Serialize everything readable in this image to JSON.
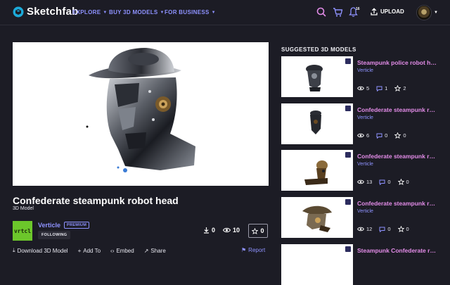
{
  "header": {
    "brand": "Sketchfab",
    "nav": [
      "EXPLORE",
      "BUY 3D MODELS",
      "FOR BUSINESS"
    ],
    "notification_count": "16",
    "upload_label": "UPLOAD"
  },
  "model": {
    "title": "Confederate steampunk robot head",
    "subtitle": "3D Model",
    "author": "Verticle",
    "author_logo_text": "vrtcl",
    "premium_label": "PREMIUM",
    "following_label": "FOLLOWING",
    "downloads": "0",
    "views": "10",
    "likes": "0"
  },
  "actions": {
    "download": "Download 3D Model",
    "add_to": "Add To",
    "embed": "Embed",
    "share": "Share",
    "report": "Report"
  },
  "suggested": {
    "heading": "SUGGESTED 3D MODELS",
    "items": [
      {
        "title": "Steampunk police robot head",
        "author": "Verticle",
        "views": "5",
        "comments": "1",
        "likes": "2"
      },
      {
        "title": "Confederate steampunk robot",
        "author": "Verticle",
        "views": "6",
        "comments": "0",
        "likes": "0"
      },
      {
        "title": "Confederate steampunk robot",
        "author": "Verticle",
        "views": "13",
        "comments": "0",
        "likes": "0"
      },
      {
        "title": "Confederate steampunk robot",
        "author": "Verticle",
        "views": "12",
        "comments": "0",
        "likes": "0"
      },
      {
        "title": "Steampunk Confederate robot",
        "author": "",
        "views": "",
        "comments": "",
        "likes": ""
      }
    ]
  },
  "colors": {
    "background": "#1c1c25",
    "accent": "#8e92ff",
    "card_title": "#e38ce8",
    "author_logo": "#6cc62b"
  }
}
